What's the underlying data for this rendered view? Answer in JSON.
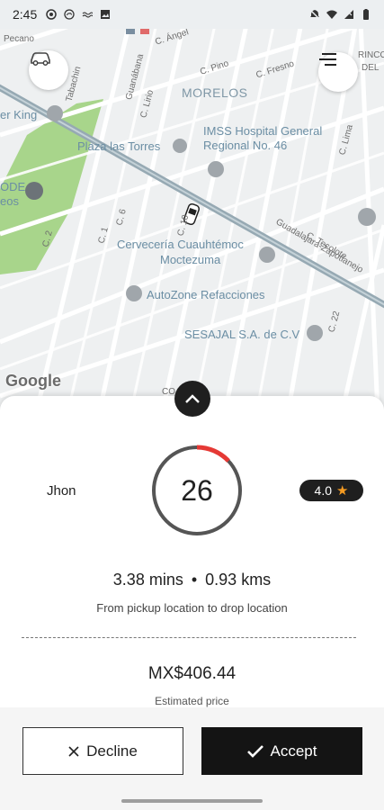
{
  "status_bar": {
    "time": "2:45",
    "left_icons": [
      "target-icon",
      "cloud-icon",
      "wave-icon",
      "image-icon"
    ],
    "right_icons": [
      "mute-icon",
      "wifi-icon",
      "signal-icon",
      "battery-icon"
    ]
  },
  "map": {
    "labels": {
      "area": "MORELOS",
      "pecano": "Pecano",
      "c_angel": "C. Ángel",
      "c_pino": "C. Pino",
      "c_fresno": "C. Fresno",
      "rincon": "RINCO",
      "del": "DEL",
      "calle_tabachin": "Tabachin",
      "calle_guanabana": "Guanábana",
      "c_lirio": "C. Lirio",
      "burger": "er King",
      "plaza": "Plaza las Torres",
      "imss1": "IMSS Hospital General",
      "imss2": "Regional No. 46",
      "c_lima": "C. Lima",
      "ode": "ODE",
      "eos": "eos",
      "c2": "C. 2",
      "c1": "C. 1",
      "c6": "C. 6",
      "c10": "C. 10",
      "cerveceria1": "Cervecería Cuauhtémoc",
      "cerveceria2": "Moctezuma",
      "guadalajara": "Guadalajara-Zapotlanejo",
      "c_tecolote": "C. Tecolote",
      "autozone": "AutoZone Refacciones",
      "c22": "C. 22",
      "sesajal": "SESAJAL S.A. de C.V",
      "co": "CO"
    },
    "google_logo": "Google",
    "colors": {
      "background": "#eef0f1",
      "park": "#a8d58b",
      "rail": "#96a9b3",
      "route_label": "#6b8ea4"
    }
  },
  "trip": {
    "rider_name": "Jhon",
    "countdown": "26",
    "countdown_progress_fraction": 0.13,
    "rating": "4.0",
    "duration": "3.38 mins",
    "separator": "•",
    "distance": "0.93 kms",
    "description": "From pickup location to drop location",
    "price": "MX$406.44",
    "price_caption": "Estimated price"
  },
  "actions": {
    "decline_label": "Decline",
    "accept_label": "Accept"
  },
  "colors": {
    "accent": "#e53935",
    "ring": "#555555",
    "dark": "#141414",
    "star": "#f59b22"
  }
}
